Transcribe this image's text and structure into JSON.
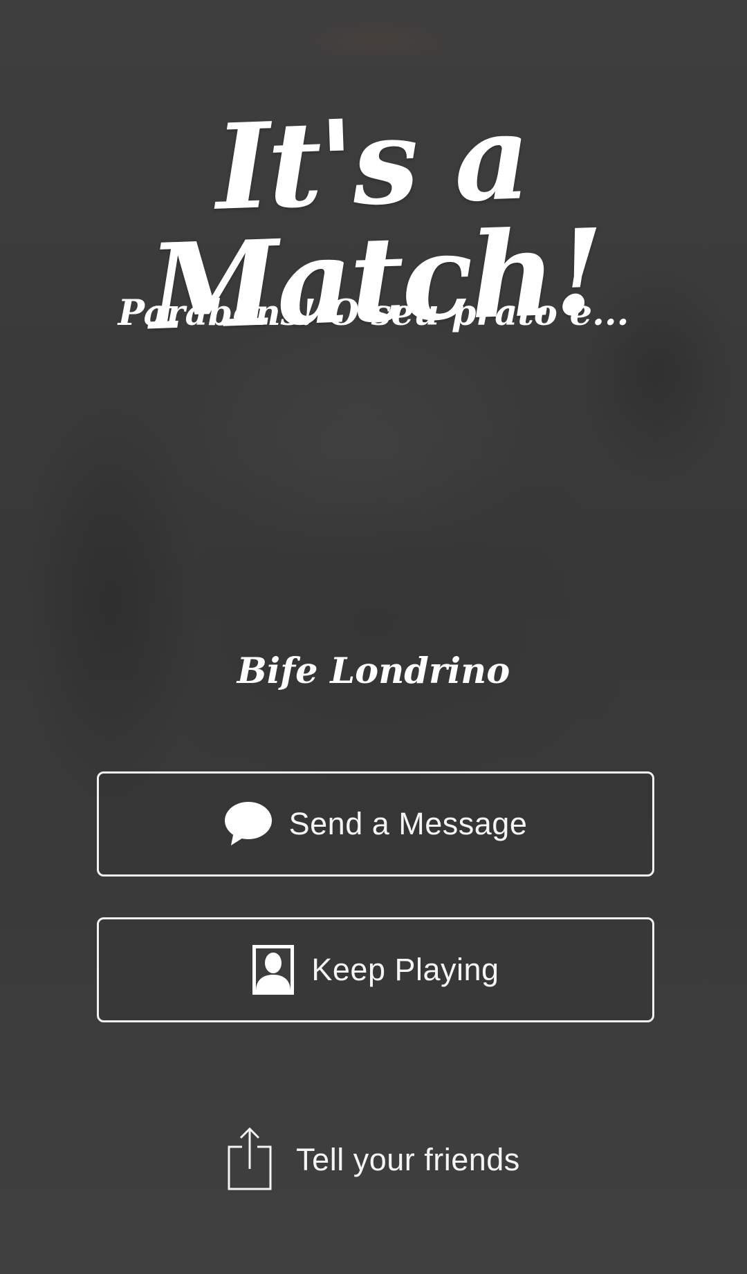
{
  "header": {
    "title": "It's a Match!",
    "subtitle": "Parabens! O seu prato e..."
  },
  "match": {
    "dish_name": "Bife Londrino"
  },
  "actions": {
    "send_message": {
      "label": "Send a Message",
      "icon": "speech-bubble-icon"
    },
    "keep_playing": {
      "label": "Keep Playing",
      "icon": "person-portrait-icon"
    },
    "tell_friends": {
      "label": "Tell your friends",
      "icon": "share-icon"
    }
  },
  "colors": {
    "background": "#3d3d3d",
    "text": "#ffffff",
    "button_border": "#f2f2f2"
  }
}
